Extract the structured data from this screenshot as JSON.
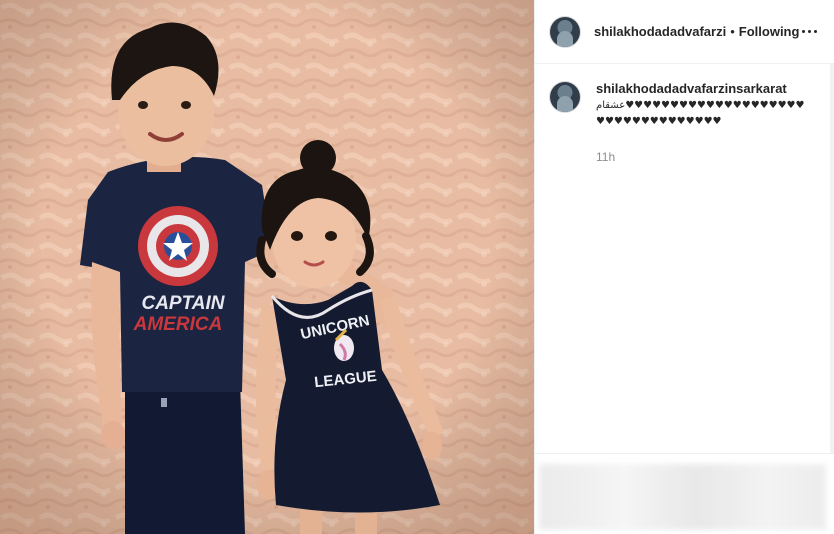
{
  "post": {
    "author": "shilakhodadadvafarzi",
    "separator": "•",
    "follow_state": "Following",
    "more_icon": "more-horizontal-icon"
  },
  "caption": {
    "author": "shilakhodadadvafarzinsarkarat",
    "text": "عشقام♥♥♥♥♥♥♥♥♥♥♥♥♥♥♥♥♥♥♥♥♥♥♥♥♥♥♥♥♥♥♥♥♥♥",
    "time": "11h"
  },
  "photo": {
    "left_shirt_line1": "CAPTAIN",
    "left_shirt_line2": "AMERICA",
    "right_dress_line1": "UNICORN",
    "right_dress_line2": "LEAGUE",
    "colors": {
      "wall": "#e9bfa6",
      "navy": "#1b2440",
      "red": "#c8383c"
    }
  }
}
